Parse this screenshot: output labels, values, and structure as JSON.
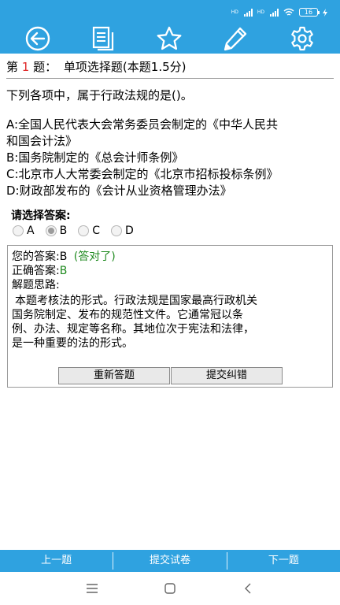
{
  "status_bar": {
    "signal1_label": "HD",
    "signal2_label": "HD",
    "battery": "16"
  },
  "toolbar": {
    "icons": [
      "back-icon",
      "notes-icon",
      "star-icon",
      "pencil-icon",
      "gear-icon"
    ]
  },
  "question": {
    "prefix": "第",
    "number": "1",
    "suffix": "题：",
    "type": "单项选择题(本题1.5分)",
    "text": "下列各项中，属于行政法规的是()。",
    "options": [
      "A:全国人民代表大会常务委员会制定的《中华人民共",
      "和国会计法》",
      "B:国务院制定的《总会计师条例》",
      "C:北京市人大常委会制定的《北京市招标投标条例》",
      "D:财政部发布的《会计从业资格管理办法》"
    ]
  },
  "answer_section": {
    "prompt": "请选择答案:",
    "choices": [
      "A",
      "B",
      "C",
      "D"
    ],
    "selected": "B"
  },
  "result": {
    "your_answer_label": "您的答案:B",
    "your_answer_status": "(答对了)",
    "correct_label": "正确答案:",
    "correct_value": "B",
    "explain_label": "解题思路:",
    "explanation_lines": [
      "本题考核法的形式。行政法规是国家最高行政机关",
      "国务院制定、发布的规范性文件。它通常冠以条",
      "例、办法、规定等名称。其地位次于宪法和法律，",
      "是一种重要的法的形式。"
    ],
    "redo_button": "重新答题",
    "report_button": "提交纠错"
  },
  "bottom_bar": {
    "prev": "上一题",
    "submit": "提交试卷",
    "next": "下一题"
  },
  "navigation": {
    "icons": [
      "menu-icon",
      "home-icon",
      "back-nav-icon"
    ]
  },
  "colors": {
    "primary": "#2fa2e0",
    "question_number": "#e02b2b",
    "correct": "#1f8a1f"
  }
}
